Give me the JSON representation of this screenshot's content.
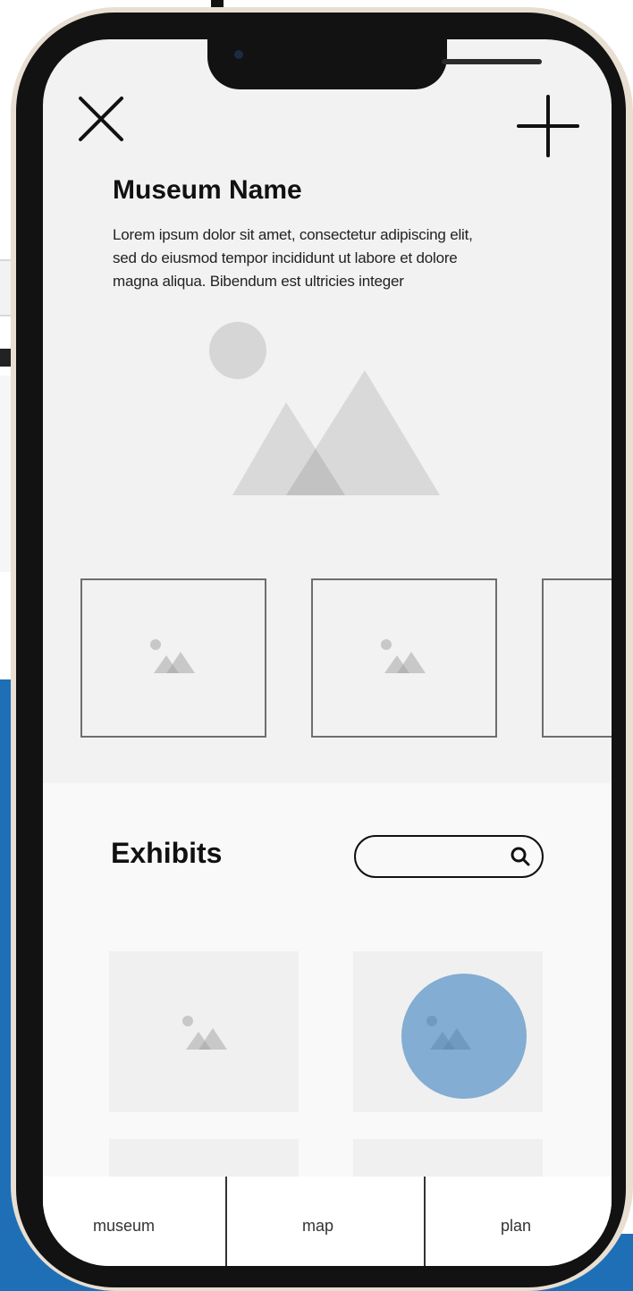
{
  "header": {
    "close_icon": "close-icon",
    "add_icon": "plus-icon"
  },
  "museum": {
    "name": "Museum Name",
    "description": "Lorem ipsum dolor sit amet, consectetur adipiscing elit, sed do eiusmod tempor incididunt ut labore et dolore magna aliqua. Bibendum est ultricies integer"
  },
  "exhibits": {
    "title": "Exhibits",
    "search_value": "",
    "search_placeholder": ""
  },
  "tabs": [
    {
      "label": "museum"
    },
    {
      "label": "map"
    },
    {
      "label": "plan"
    }
  ],
  "colors": {
    "accent": "#1f6fb6",
    "screen_bg": "#f2f2f2",
    "placeholder_gray": "#c8c8c8"
  }
}
